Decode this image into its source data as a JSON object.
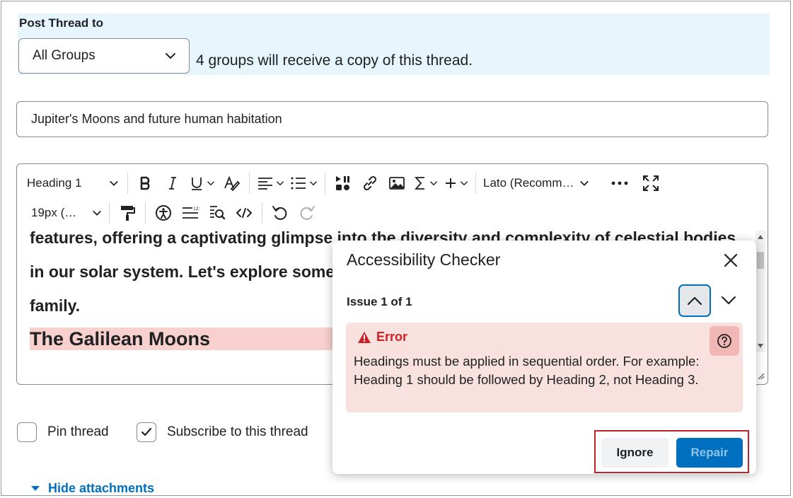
{
  "post_thread": {
    "label": "Post Thread to",
    "group_select_value": "All Groups",
    "group_note": "4 groups will receive a copy of this thread."
  },
  "subject": {
    "value": "Jupiter's Moons and future human habitation"
  },
  "toolbar": {
    "block_format": "Heading 1",
    "font_family": "Lato (Recomm…",
    "font_size": "19px (…",
    "icons": [
      "bold-icon",
      "italic-icon",
      "underline-icon",
      "format-clear-icon",
      "align-icon",
      "list-icon",
      "media-icon",
      "link-icon",
      "image-icon",
      "equation-icon",
      "insert-plus-icon",
      "more-icon",
      "fullscreen-icon",
      "format-painter-icon",
      "accessibility-icon",
      "line-spacing-icon",
      "find-icon",
      "source-code-icon",
      "undo-icon",
      "redo-icon"
    ]
  },
  "editor": {
    "lines": [
      "features, offering a captivating glimpse into the diversity and complexity of celestial bodies",
      "in our solar system. Let's explore some",
      "family."
    ],
    "heading": "The Galilean Moons"
  },
  "options": {
    "pin_label": "Pin thread",
    "pin_checked": false,
    "subscribe_label": "Subscribe to this thread",
    "subscribe_checked": true
  },
  "attachments": {
    "toggle_label": "Hide attachments"
  },
  "dialog": {
    "title": "Accessibility Checker",
    "issue_counter": "Issue 1 of 1",
    "error_label": "Error",
    "error_message": "Headings must be applied in sequential order. For example: Heading 1 should be followed by Heading 2, not Heading 3.",
    "ignore_label": "Ignore",
    "repair_label": "Repair"
  },
  "colors": {
    "accent": "#006fbf",
    "post_band_bg": "#e6f6fc",
    "error_bg": "#f9e1e0",
    "error_text": "#cd2026",
    "heading_highlight": "#f8d0ce",
    "focus_outline": "#c0202a"
  }
}
